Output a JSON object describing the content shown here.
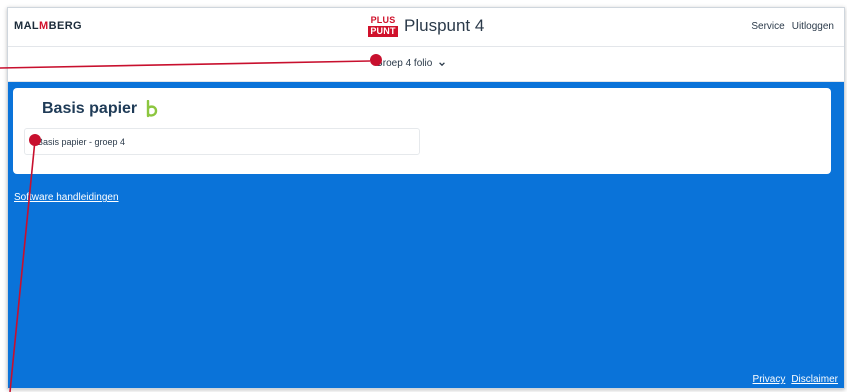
{
  "header": {
    "brand_prefix": "MAL",
    "brand_m": "M",
    "brand_suffix": "BERG",
    "product_logo_top": "PLUS",
    "product_logo_bottom": "PUNT",
    "product_title": "Pluspunt 4",
    "nav": [
      "Service",
      "Uitloggen"
    ]
  },
  "group_selector": {
    "value": "Groep 4 folio",
    "icon": "chevron-down-icon"
  },
  "card": {
    "title": "Basis papier",
    "title_icon": "b-logo-icon",
    "items": [
      {
        "label": "Basis papier - groep 4"
      }
    ]
  },
  "links": {
    "software": "Software handleidingen"
  },
  "footer": {
    "privacy": "Privacy",
    "disclaimer": "Disclaimer"
  },
  "colors": {
    "content_bg": "#0a73d9",
    "brand_red": "#d0112b",
    "annotation_red": "#c8102e",
    "b_icon_green": "#8cc63f"
  }
}
